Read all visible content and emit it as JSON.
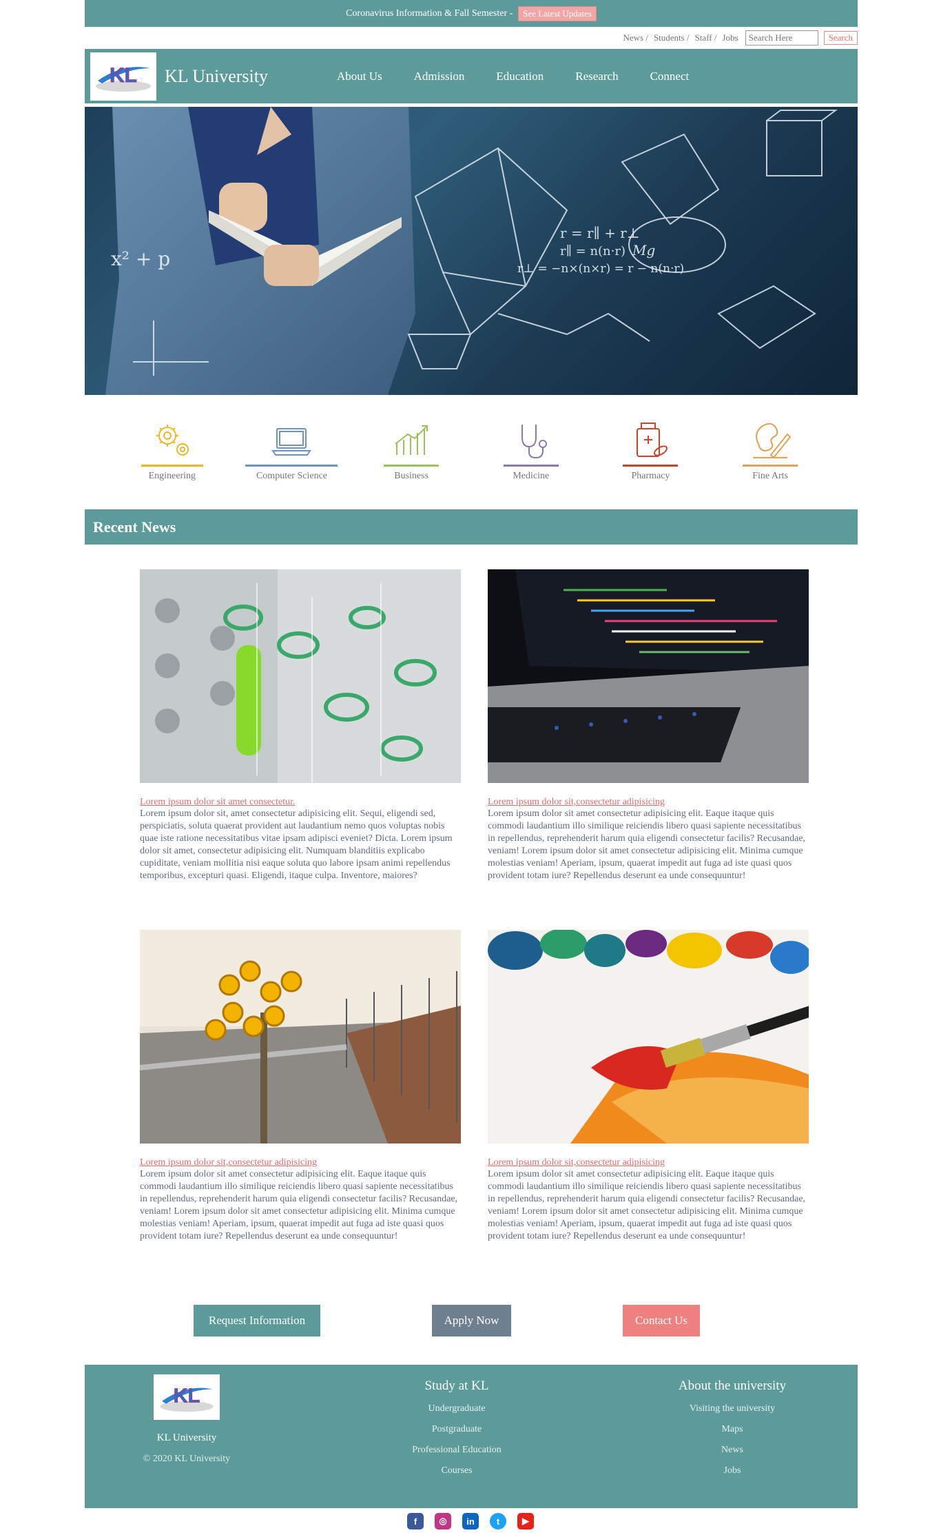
{
  "topbar": {
    "text": "Coronavirus Information & Fall Semester -",
    "link": "See Latest Updates"
  },
  "utility": {
    "links": [
      "News /",
      "Students /",
      "Staff /",
      "Jobs"
    ],
    "search_placeholder": "Search Here",
    "search_button": "Search"
  },
  "nav": {
    "logo_text": "KL",
    "brand": "KL University",
    "links": [
      "About Us",
      "Admission",
      "Education",
      "Research",
      "Connect"
    ]
  },
  "categories": [
    {
      "label": "Engineering",
      "icon": "gears-icon",
      "color": "#e8b923"
    },
    {
      "label": "Computer Science",
      "icon": "laptop-icon",
      "color": "#6a93c9"
    },
    {
      "label": "Business",
      "icon": "growth-chart-icon",
      "color": "#9cc35a"
    },
    {
      "label": "Medicine",
      "icon": "stethoscope-icon",
      "color": "#8a7aa8"
    },
    {
      "label": "Pharmacy",
      "icon": "medicine-bottle-icon",
      "color": "#c8442a"
    },
    {
      "label": "Fine Arts",
      "icon": "palette-brush-icon",
      "color": "#e4a055"
    }
  ],
  "recent_news": {
    "heading": "Recent News",
    "items": [
      {
        "title": "Lorem ipsum dolor sit amet consectetur.",
        "body": "Lorem ipsum dolor sit, amet consectetur adipisicing elit. Sequi, eligendi sed, perspiciatis, soluta quaerat provident aut laudantium nemo quos voluptas nobis quae iste ratione necessitatibus vitae ipsam adipisci eveniet? Dicta. Lorem ipsum dolor sit amet, consectetur adipisicing elit. Numquam blanditiis explicabo cupiditate, veniam mollitia nisi eaque soluta quo labore ipsam animi repellendus temporibus, excepturi quasi. Eligendi, itaque culpa. Inventore, maiores?"
      },
      {
        "title": "Lorem ipsum dolor sit,consectetur adipisicing",
        "body": "Lorem ipsum dolor sit amet consectetur adipisicing elit. Eaque itaque quis commodi laudantium illo similique reiciendis libero quasi sapiente necessitatibus in repellendus, reprehenderit harum quia eligendi consectetur facilis? Recusandae, veniam! Lorem ipsum dolor sit amet consectetur adipisicing elit. Minima cumque molestias veniam! Aperiam, ipsum, quaerat impedit aut fuga ad iste quasi quos provident totam iure? Repellendus deserunt ea unde consequuntur!"
      },
      {
        "title": "Lorem ipsum dolor sit,consectetur adipisicing",
        "body": "Lorem ipsum dolor sit amet consectetur adipisicing elit. Eaque itaque quis commodi laudantium illo similique reiciendis libero quasi sapiente necessitatibus in repellendus, reprehenderit harum quia eligendi consectetur facilis? Recusandae, veniam! Lorem ipsum dolor sit amet consectetur adipisicing elit. Minima cumque molestias veniam! Aperiam, ipsum, quaerat impedit aut fuga ad iste quasi quos provident totam iure? Repellendus deserunt ea unde consequuntur!"
      },
      {
        "title": "Lorem ipsum dolor sit,consectetur adipisicing",
        "body": "Lorem ipsum dolor sit amet consectetur adipisicing elit. Eaque itaque quis commodi laudantium illo similique reiciendis libero quasi sapiente necessitatibus in repellendus, reprehenderit harum quia eligendi consectetur facilis? Recusandae, veniam! Lorem ipsum dolor sit amet consectetur adipisicing elit. Minima cumque molestias veniam! Aperiam, ipsum, quaerat impedit aut fuga ad iste quasi quos provident totam iure? Repellendus deserunt ea unde consequuntur!"
      }
    ]
  },
  "cta": {
    "request": {
      "label": "Request Information",
      "color": "#5d9b9b"
    },
    "apply": {
      "label": "Apply Now",
      "color": "#6e8090"
    },
    "contact": {
      "label": "Contact Us",
      "color": "#ee8080"
    }
  },
  "footer": {
    "logo_text": "KL",
    "brand": "KL University",
    "copyright": "© 2020 KL University",
    "study": {
      "heading": "Study at KL",
      "links": [
        "Undergraduate",
        "Postgraduate",
        "Professional Education",
        "Courses"
      ]
    },
    "about": {
      "heading": "About the university",
      "links": [
        "Visiting the university",
        "Maps",
        "News",
        "Jobs"
      ]
    }
  },
  "social": [
    {
      "name": "facebook-icon",
      "glyph": "f",
      "color": "#3b5998"
    },
    {
      "name": "instagram-icon",
      "glyph": "◎",
      "color": "#c13584"
    },
    {
      "name": "linkedin-icon",
      "glyph": "in",
      "color": "#0a66c2"
    },
    {
      "name": "twitter-icon",
      "glyph": "t",
      "color": "#1da1f2"
    },
    {
      "name": "youtube-icon",
      "glyph": "▶",
      "color": "#e62117"
    }
  ],
  "hero": {
    "formulas": [
      "r = r∥ + r⊥",
      "r∥ = n(n·r)",
      "r⊥ = −n×(n×r) = r − n(n·r)",
      "x² + p",
      "Mg"
    ]
  }
}
